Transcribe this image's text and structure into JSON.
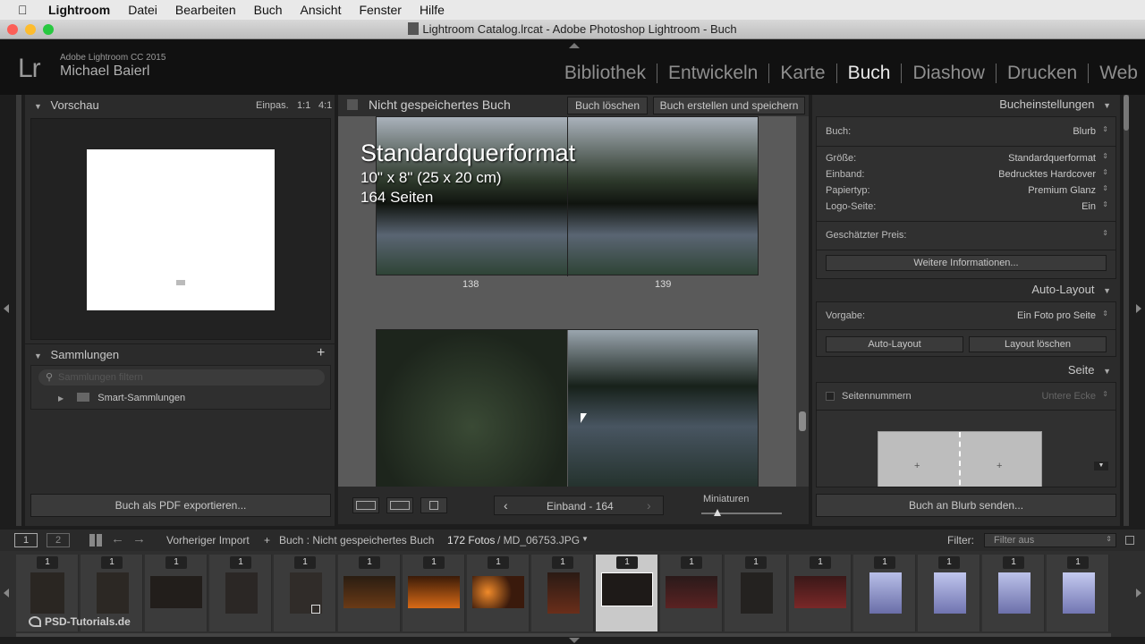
{
  "menubar": {
    "items": [
      "Lightroom",
      "Datei",
      "Bearbeiten",
      "Buch",
      "Ansicht",
      "Fenster",
      "Hilfe"
    ]
  },
  "window": {
    "title": "Lightroom Catalog.lrcat - Adobe Photoshop Lightroom - Buch"
  },
  "identity": {
    "logo": "Lr",
    "product": "Adobe Lightroom CC 2015",
    "user": "Michael Baierl"
  },
  "modules": [
    "Bibliothek",
    "Entwickeln",
    "Karte",
    "Buch",
    "Diashow",
    "Drucken",
    "Web"
  ],
  "active_module": "Buch",
  "left_panel": {
    "preview_title": "Vorschau",
    "zoom_fit": "Einpas.",
    "zoom_1": "1:1",
    "zoom_4": "4:1",
    "collections_title": "Sammlungen",
    "filter_placeholder": "Sammlungen filtern",
    "smart_collections": "Smart-Sammlungen",
    "export_pdf": "Buch als PDF exportieren..."
  },
  "center": {
    "book_title": "Nicht gespeichertes Buch",
    "delete_book": "Buch löschen",
    "create_save": "Buch erstellen und speichern",
    "format_title": "Standardquerformat",
    "format_size": "10\" x 8\" (25 x 20 cm)",
    "format_pages": "164 Seiten",
    "page_left": "138",
    "page_right": "139",
    "nav_label": "Einband - 164",
    "thumbs_label": "Miniaturen",
    "thumb_slider": 0.2
  },
  "right_panel": {
    "book_settings_title": "Bucheinstellungen",
    "book_label": "Buch:",
    "book_value": "Blurb",
    "size_label": "Größe:",
    "size_value": "Standardquerformat",
    "cover_label": "Einband:",
    "cover_value": "Bedrucktes Hardcover",
    "paper_label": "Papiertyp:",
    "paper_value": "Premium Glanz",
    "logo_label": "Logo-Seite:",
    "logo_value": "Ein",
    "price_label": "Geschätzter Preis:",
    "more_info": "Weitere Informationen...",
    "auto_layout_title": "Auto-Layout",
    "preset_label": "Vorgabe:",
    "preset_value": "Ein Foto pro Seite",
    "auto_layout_btn": "Auto-Layout",
    "clear_layout_btn": "Layout löschen",
    "page_title": "Seite",
    "page_numbers_label": "Seitennummern",
    "page_numbers_value": "Untere Ecke",
    "send_blurb": "Buch an Blurb senden..."
  },
  "filmstrip": {
    "view1": "1",
    "view2": "2",
    "source_prev": "Vorheriger Import",
    "source_current": "Buch : Nicht gespeichertes Buch",
    "count": "172 Fotos",
    "filename": "/ MD_06753.JPG",
    "filter_label": "Filter:",
    "filter_value": "Filter aus",
    "badge": "1",
    "watermark": "PSD-Tutorials.de"
  }
}
